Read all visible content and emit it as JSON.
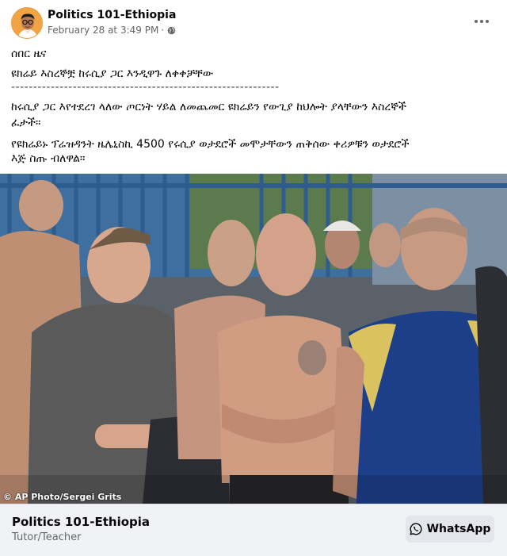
{
  "post": {
    "page_name": "Politics 101-Ethiopia",
    "timestamp": "February 28 at 3:49 PM",
    "separator": "·",
    "privacy_icon": "globe-icon",
    "more_icon": "more-options-icon"
  },
  "body_text": {
    "line1": "ሰበር ዜና",
    "line2": "ዩክሬይ እስረኞቿ ከሩሲያ ጋር እንዲዋጉ ለቀቀቻቸው",
    "divider": "-------------------------------------------------------------",
    "line3": "ከሩሲያ ጋር እየተደረገ ላለው ጦርነት ሃይል ለመጨመር ዩክሬይን የውጊያ ከህሎት ያላቸውን እስረኞች",
    "line4": "ፈታች።",
    "line5": "የዩክሬይኑ ፕሬዝዳንት ዜሌኒስኪ 4500 የሩሲያ ወታደሮች መሞታቸውን ጠቅሰው ቀሪዎቹን ወታደሮች",
    "line6": "እጅ ስጡ ብለዋል።"
  },
  "photo": {
    "credit": "© AP Photo/Sergei Grits",
    "subject": "men-standing-in-prison-yard"
  },
  "footer": {
    "name": "Politics 101-Ethiopia",
    "subtitle": "Tutor/Teacher",
    "button_label": "WhatsApp",
    "button_icon": "whatsapp-icon"
  },
  "colors": {
    "secondary_text": "#65676b",
    "footer_bg": "#f0f2f5",
    "button_bg": "#e4e6eb"
  }
}
